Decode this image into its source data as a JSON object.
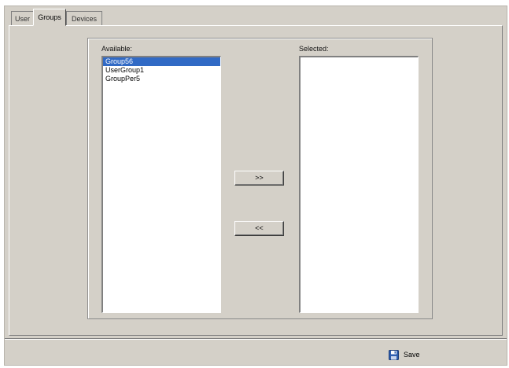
{
  "tabs": [
    {
      "label": "User",
      "active": false
    },
    {
      "label": "Groups",
      "active": true
    },
    {
      "label": "Devices",
      "active": false
    }
  ],
  "available": {
    "label": "Available:",
    "items": [
      {
        "label": "Group56",
        "selected": true
      },
      {
        "label": "UserGroup1",
        "selected": false
      },
      {
        "label": "GroupPer5",
        "selected": false
      }
    ]
  },
  "selected": {
    "label": "Selected:",
    "items": []
  },
  "buttons": {
    "add_label": ">>",
    "remove_label": "<<"
  },
  "footer": {
    "save_label": "Save",
    "save_icon": "floppy-disk-icon"
  },
  "colors": {
    "window_bg": "#d4d0c8",
    "selection": "#316ac5"
  }
}
